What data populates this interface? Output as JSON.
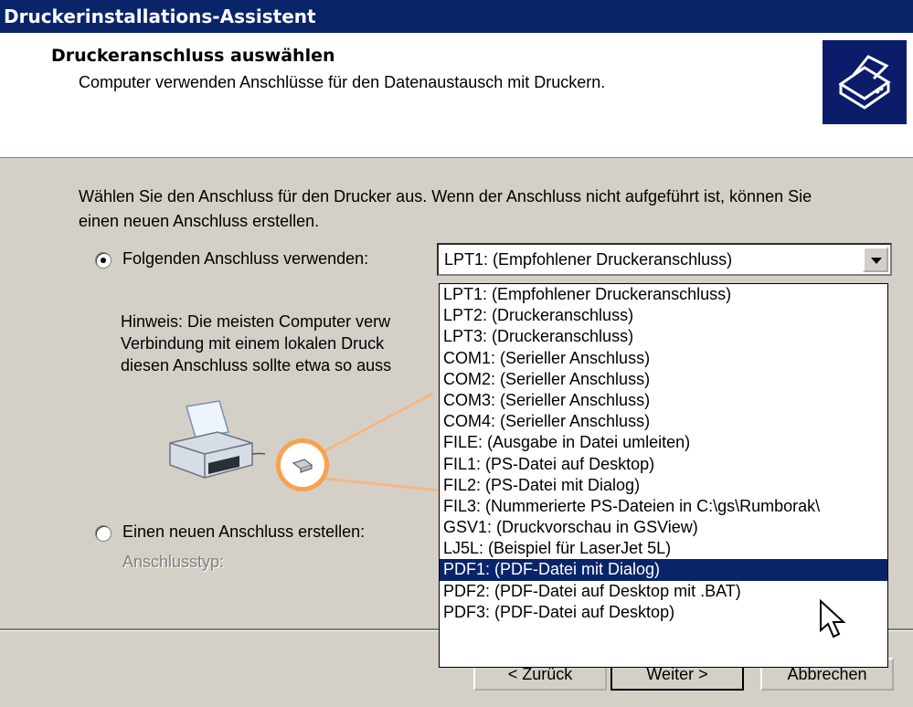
{
  "window": {
    "title": "Druckerinstallations-Assistent"
  },
  "header": {
    "title": "Druckeranschluss auswählen",
    "subtitle": "Computer verwenden Anschlüsse für den Datenaustausch mit Druckern.",
    "icon": "printer-wizard-icon"
  },
  "body": {
    "description": "Wählen Sie den Anschluss für den Drucker aus. Wenn der Anschluss nicht aufgeführt ist, können Sie einen neuen Anschluss erstellen.",
    "use_existing_label": "Folgenden Anschluss verwenden:",
    "use_existing_checked": true,
    "hint_lines": [
      "Hinweis: Die meisten Computer verw",
      "Verbindung mit einem lokalen Druck",
      "diesen Anschluss sollte etwa so auss"
    ],
    "create_new_label": "Einen neuen Anschluss erstellen:",
    "port_type_label": "Anschlusstyp:"
  },
  "port_combo": {
    "value": "LPT1: (Empfohlener Druckeranschluss)",
    "options": [
      "LPT1: (Empfohlener Druckeranschluss)",
      "LPT2: (Druckeranschluss)",
      "LPT3: (Druckeranschluss)",
      "COM1: (Serieller Anschluss)",
      "COM2: (Serieller Anschluss)",
      "COM3: (Serieller Anschluss)",
      "COM4: (Serieller Anschluss)",
      "FILE: (Ausgabe in Datei umleiten)",
      "FIL1: (PS-Datei auf Desktop)",
      "FIL2: (PS-Datei mit Dialog)",
      "FIL3: (Nummerierte PS-Dateien in C:\\gs\\Rumborak\\",
      "GSV1: (Druckvorschau in GSView)",
      "LJ5L: (Beispiel für LaserJet 5L)",
      "PDF1: (PDF-Datei mit Dialog)",
      "PDF2: (PDF-Datei auf Desktop mit .BAT)",
      "PDF3: (PDF-Datei auf Desktop)"
    ],
    "highlighted_index": 13
  },
  "footer": {
    "back_label": "< Zurück",
    "next_label": "Weiter >",
    "cancel_label": "Abbrechen"
  },
  "colors": {
    "titlebar": "#0a246a",
    "selection": "#0a246a",
    "accent_orange": "#f7a24e"
  }
}
